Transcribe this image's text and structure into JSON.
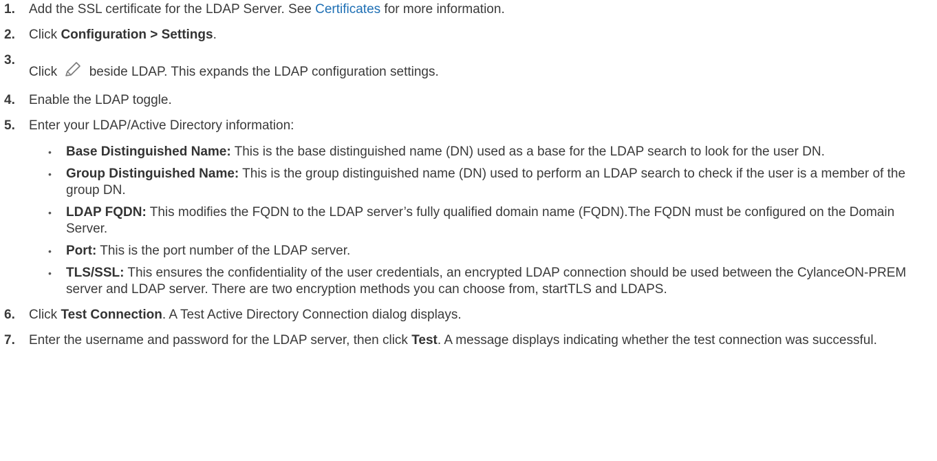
{
  "steps": [
    {
      "num": "1.",
      "pre": "Add the SSL certificate for the LDAP Server. See ",
      "link": "Certificates",
      "post": " for more information."
    },
    {
      "num": "2.",
      "pre": "Click ",
      "bold": "Configuration > Settings",
      "post": "."
    },
    {
      "num": "3.",
      "pre": "Click ",
      "icon": "pencil-edit-icon",
      "post": " beside LDAP. This expands the LDAP configuration settings."
    },
    {
      "num": "4.",
      "text": "Enable the LDAP toggle."
    },
    {
      "num": "5.",
      "text": "Enter your LDAP/Active Directory information:"
    },
    {
      "num": "6.",
      "pre": "Click ",
      "bold": "Test Connection",
      "post": ". A Test Active Directory Connection dialog displays."
    },
    {
      "num": "7.",
      "pre": "Enter the username and password for the LDAP server, then click ",
      "bold": "Test",
      "post": ". A message displays indicating whether the test connection was successful."
    }
  ],
  "ldap_fields": [
    {
      "term": "Base Distinguished Name:",
      "desc": " This is the base distinguished name (DN) used as a base for the LDAP search to look for the user DN."
    },
    {
      "term": "Group Distinguished Name:",
      "desc": " This is the group distinguished name (DN) used to perform an LDAP search to check if the user is a member of the group DN."
    },
    {
      "term": "LDAP FQDN:",
      "desc": " This modifies the FQDN to the LDAP server’s fully qualified domain name (FQDN).The FQDN must be configured on the Domain Server."
    },
    {
      "term": "Port:",
      "desc": " This is the port number of the LDAP server."
    },
    {
      "term": "TLS/SSL:",
      "desc": " This ensures the confidentiality of the user credentials, an encrypted LDAP connection should be used between the CylanceON-PREM server and LDAP server. There are two encryption methods you can choose from, startTLS and LDAPS."
    }
  ]
}
